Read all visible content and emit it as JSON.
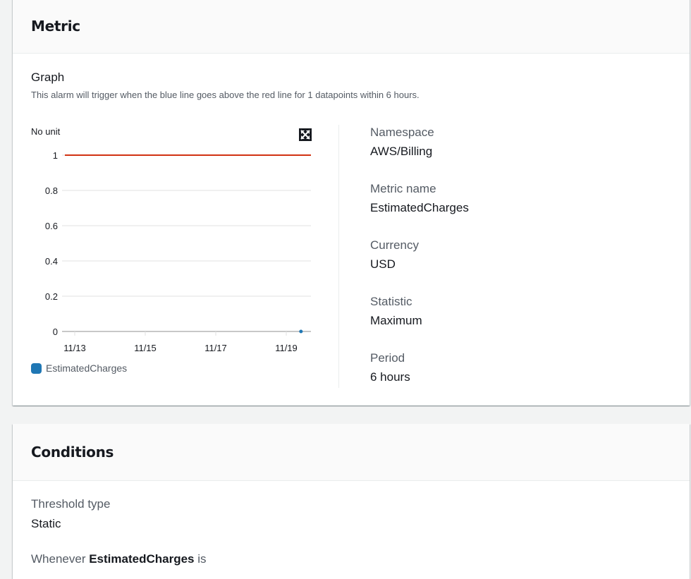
{
  "metric_panel": {
    "title": "Metric",
    "graph_title": "Graph",
    "graph_description": "This alarm will trigger when the blue line goes above the red line for 1 datapoints within 6 hours.",
    "expand_icon": "expand-arrows-icon",
    "details": [
      {
        "label": "Namespace",
        "value": "AWS/Billing"
      },
      {
        "label": "Metric name",
        "value": "EstimatedCharges"
      },
      {
        "label": "Currency",
        "value": "USD"
      },
      {
        "label": "Statistic",
        "value": "Maximum"
      },
      {
        "label": "Period",
        "value": "6 hours"
      }
    ]
  },
  "conditions_panel": {
    "title": "Conditions",
    "threshold_type_label": "Threshold type",
    "threshold_type_value": "Static",
    "whenever_prefix": "Whenever",
    "whenever_metric": "EstimatedCharges",
    "whenever_suffix": "is"
  },
  "chart_data": {
    "type": "line",
    "ylabel": "No unit",
    "ylim": [
      0,
      1
    ],
    "y_ticks": [
      "0",
      "0.2",
      "0.4",
      "0.6",
      "0.8",
      "1"
    ],
    "x_ticks": [
      "11/13",
      "11/15",
      "11/17",
      "11/19"
    ],
    "grid": true,
    "legend_position": "bottom-left",
    "threshold": {
      "value": 1,
      "color": "#d13212"
    },
    "series": [
      {
        "name": "EstimatedCharges",
        "color": "#1f77b4",
        "points": [
          {
            "x": "11/19 10:00",
            "y": 0
          }
        ]
      }
    ]
  }
}
